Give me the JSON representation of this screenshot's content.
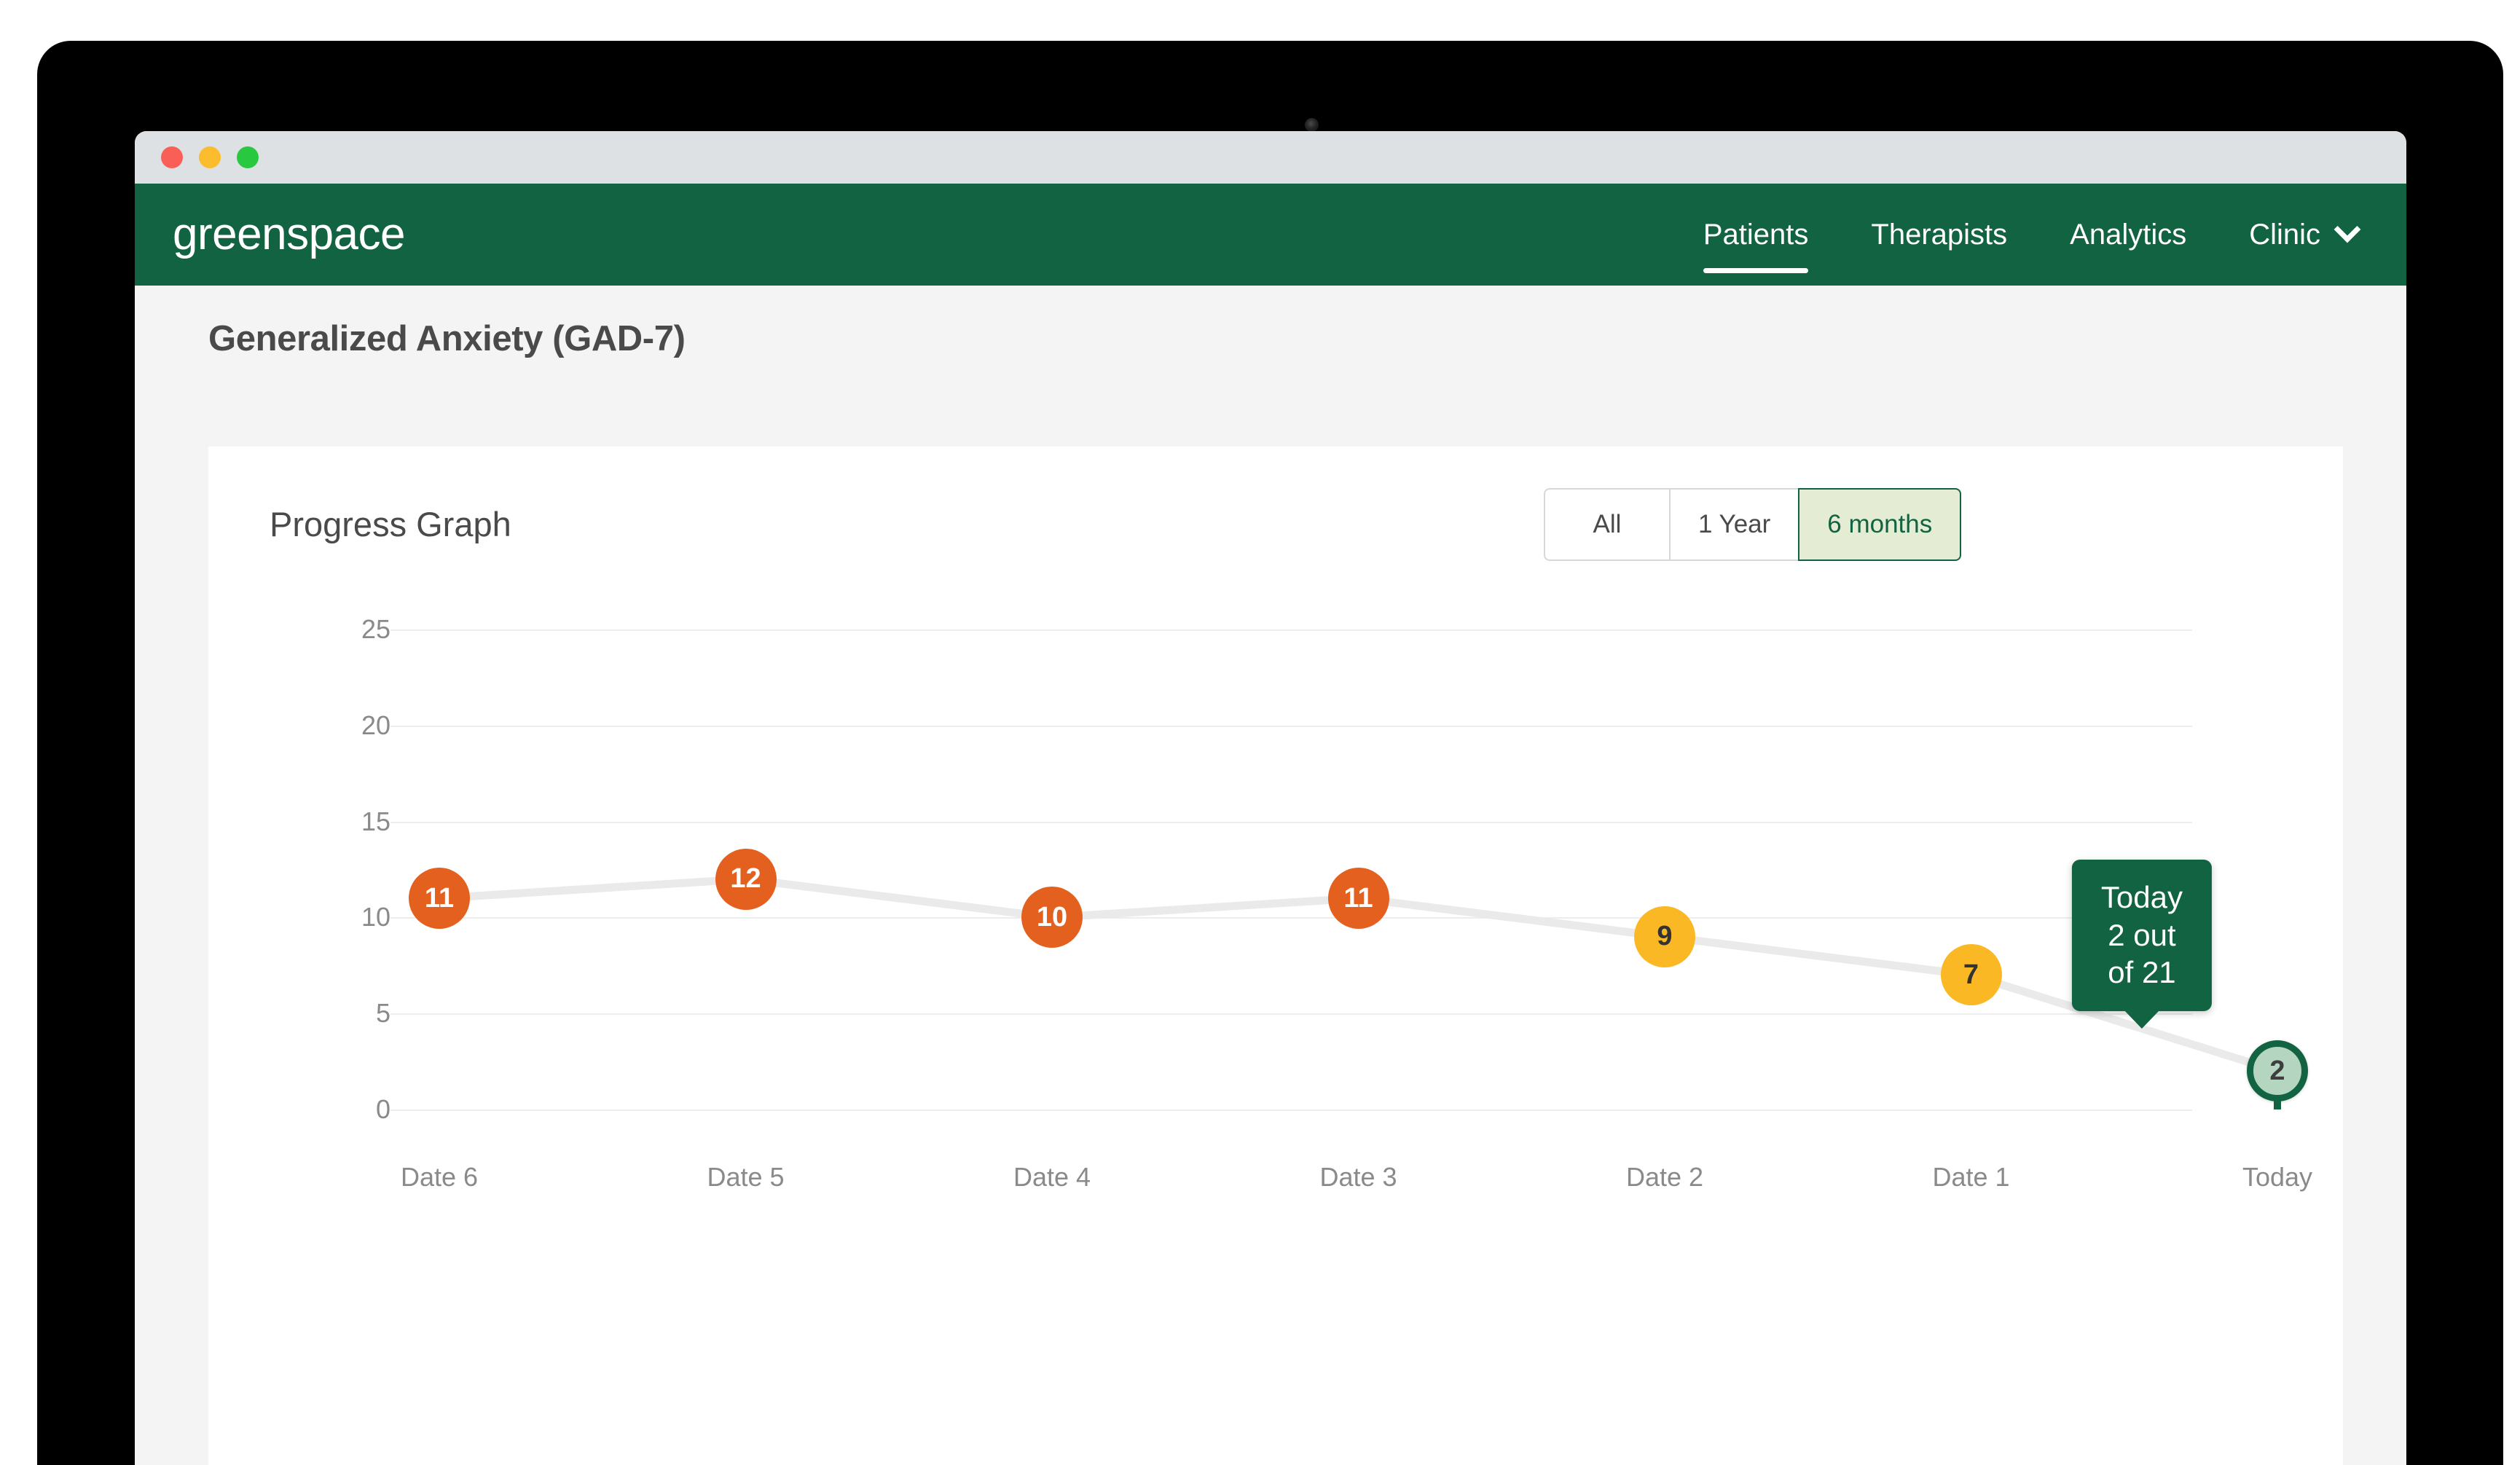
{
  "window": {
    "traffic_lights": [
      {
        "name": "close",
        "color": "#f95f57"
      },
      {
        "name": "minimize",
        "color": "#fbbd2e"
      },
      {
        "name": "maximize",
        "color": "#28c840"
      }
    ]
  },
  "nav": {
    "brand": "greenspace",
    "links": [
      {
        "label": "Patients",
        "active": true
      },
      {
        "label": "Therapists",
        "active": false
      },
      {
        "label": "Analytics",
        "active": false
      },
      {
        "label": "Clinic",
        "active": false,
        "has_chevron": true
      }
    ]
  },
  "page": {
    "title": "Generalized Anxiety (GAD-7)"
  },
  "card": {
    "title": "Progress Graph",
    "range_options": [
      {
        "label": "All",
        "active": false
      },
      {
        "label": "1 Year",
        "active": false
      },
      {
        "label": "6 months",
        "active": true
      }
    ]
  },
  "tooltip": {
    "line1": "Today",
    "line2": "2 out of 21"
  },
  "colors": {
    "brand_green": "#126341",
    "active_pill_bg": "#e4ecd4",
    "severity_orange": "#e4601f",
    "severity_yellow": "#fab825",
    "today_fill": "#b4d6c0",
    "gridline": "#ededed",
    "page_bg": "#f4f4f4"
  },
  "chart_data": {
    "type": "line",
    "title": "Progress Graph",
    "xlabel": "",
    "ylabel": "",
    "grid": true,
    "legend": "none",
    "ylim": [
      0,
      25
    ],
    "yticks": [
      25,
      20,
      15,
      10,
      5,
      0
    ],
    "categories": [
      "Date 6",
      "Date 5",
      "Date 4",
      "Date 3",
      "Date 2",
      "Date 1",
      "Today"
    ],
    "values": [
      11,
      12,
      10,
      11,
      9,
      7,
      2
    ],
    "point_labels": [
      "11",
      "12",
      "10",
      "11",
      "9",
      "7",
      "2"
    ],
    "point_styles": [
      "orange",
      "orange",
      "orange",
      "orange",
      "yellow",
      "yellow",
      "today"
    ],
    "annotations": [
      "Today 2 out of 21"
    ],
    "max_score": 21
  }
}
